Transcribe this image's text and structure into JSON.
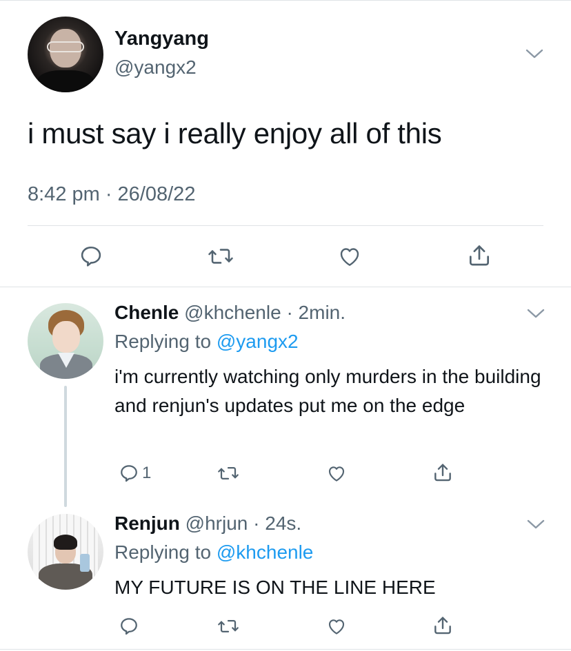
{
  "main_tweet": {
    "name": "Yangyang",
    "handle": "@yangx2",
    "text": "i must say i really enjoy all of this",
    "timestamp": "8:42 pm · 26/08/22",
    "actions": [
      "reply-icon",
      "retweet-icon",
      "like-icon",
      "share-icon"
    ]
  },
  "replies": [
    {
      "name": "Chenle",
      "handle": "@khchenle",
      "time": "· 2min.",
      "replying_prefix": "Replying to",
      "replying_to": "@yangx2",
      "text": "i'm currently watching only murders in the building and renjun's updates put me on the edge",
      "reply_count": "1"
    },
    {
      "name": "Renjun",
      "handle": "@hrjun",
      "time": "· 24s.",
      "replying_prefix": "Replying to",
      "replying_to": "@khchenle",
      "text": "MY FUTURE IS ON THE LINE HERE",
      "reply_count": ""
    }
  ],
  "colors": {
    "text": "#0f1419",
    "secondary": "#536471",
    "link": "#1d9bf0",
    "divider": "#dfe3e6"
  }
}
